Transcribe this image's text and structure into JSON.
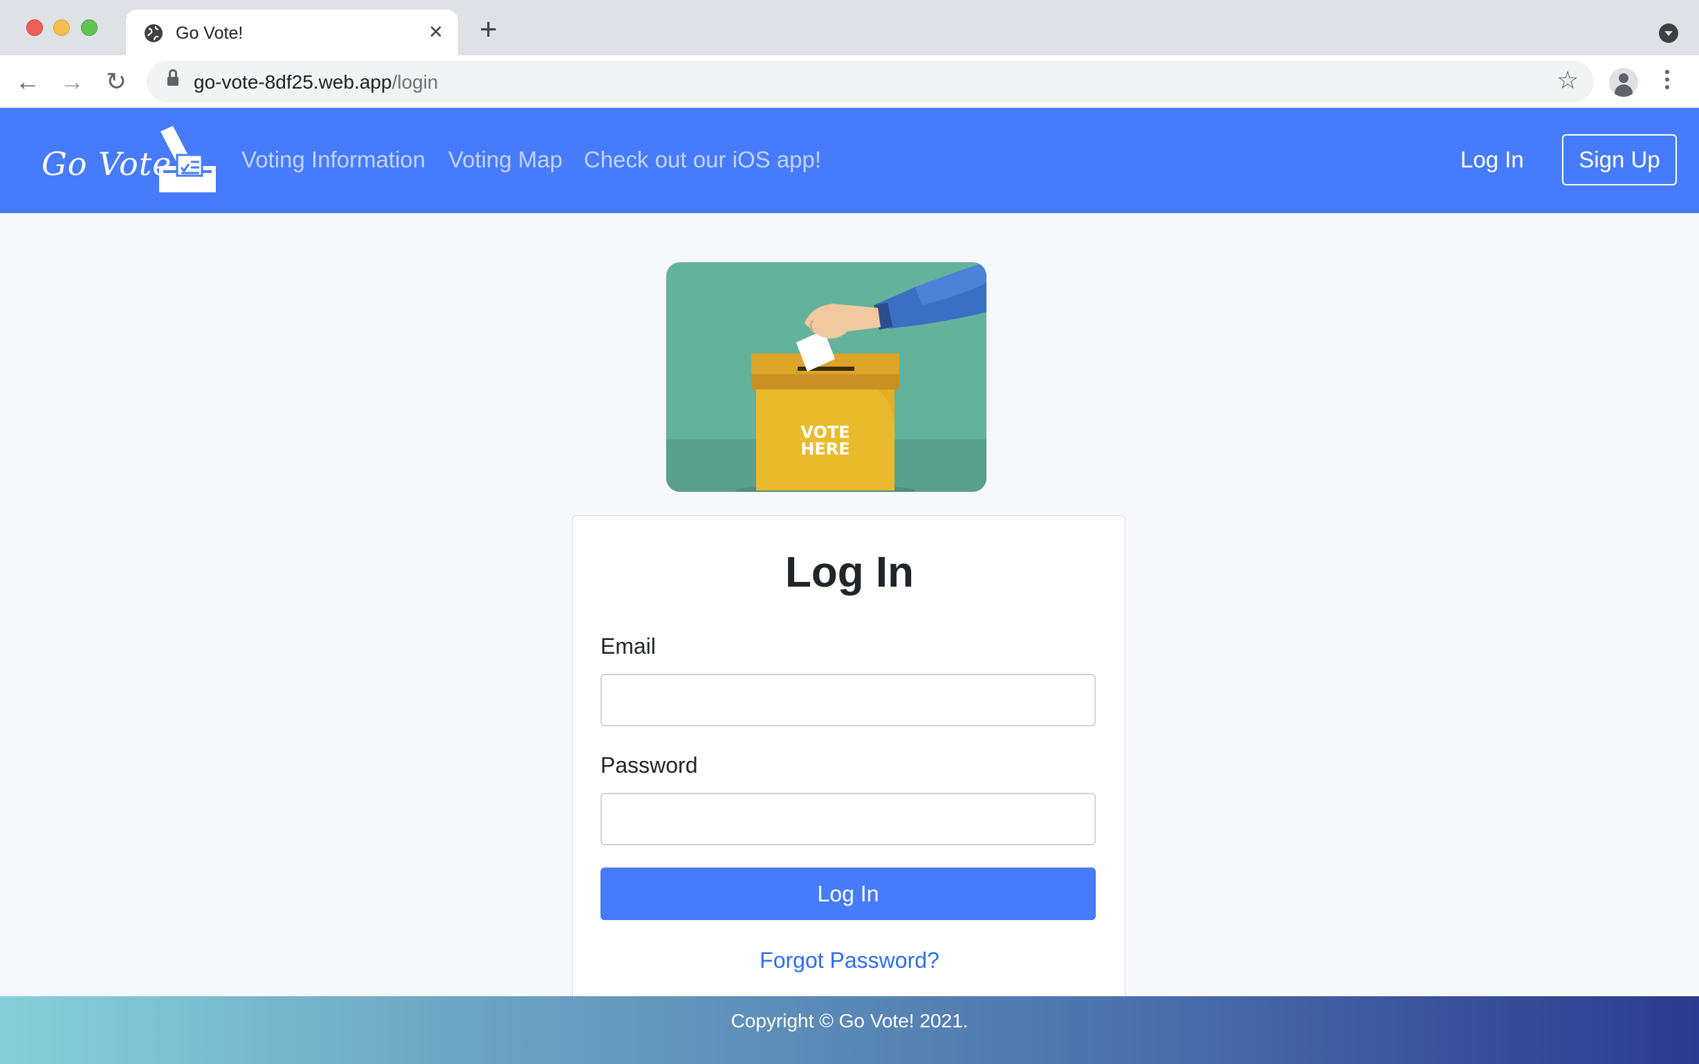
{
  "browser": {
    "tab_title": "Go Vote!",
    "url_host": "go-vote-8df25.web.app",
    "url_path": "/login"
  },
  "navbar": {
    "brand": "Go Vote!",
    "links": [
      "Voting Information",
      "Voting Map",
      "Check out our iOS app!"
    ],
    "login": "Log In",
    "signup": "Sign Up"
  },
  "hero": {
    "box_text_line1": "VOTE",
    "box_text_line2": "HERE"
  },
  "login_form": {
    "title": "Log In",
    "email_label": "Email",
    "email_value": "",
    "password_label": "Password",
    "password_value": "",
    "submit_label": "Log In",
    "forgot_link": "Forgot Password?"
  },
  "footer": {
    "copyright": "Copyright © Go Vote! 2021."
  },
  "colors": {
    "primary": "#467bfb",
    "link": "#2f6df5",
    "page_bg": "#f7f8fc",
    "hero_bg": "#63b39c",
    "ballot_box": "#e7b62f"
  }
}
